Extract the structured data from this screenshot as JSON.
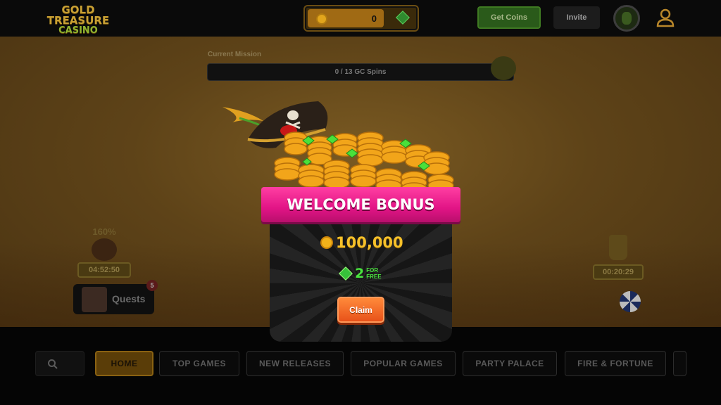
{
  "header": {
    "logo_line1": "GOLD TREASURE",
    "logo_line2": "CASINO",
    "balance_gc": "0",
    "get_coins_label": "Get Coins",
    "invite_label": "Invite"
  },
  "mission": {
    "label": "Current Mission",
    "progress_text": "0 / 13 GC Spins",
    "progress_fraction": 0
  },
  "side": {
    "boost_percent": "160%",
    "boost_timer": "04:52:50",
    "quests_label": "Quests",
    "quests_badge": "5",
    "trophy_timer": "00:20:29"
  },
  "modal": {
    "title": "WELCOME BONUS",
    "coins_amount": "100,000",
    "gems_amount": "2",
    "gems_suffix_line1": "FOR",
    "gems_suffix_line2": "FREE",
    "claim_label": "Claim"
  },
  "nav": {
    "tabs": [
      {
        "label": "HOME",
        "active": true
      },
      {
        "label": "TOP GAMES",
        "active": false
      },
      {
        "label": "NEW RELEASES",
        "active": false
      },
      {
        "label": "POPULAR GAMES",
        "active": false
      },
      {
        "label": "PARTY PALACE",
        "active": false
      },
      {
        "label": "FIRE & FORTUNE",
        "active": false
      }
    ]
  },
  "icons": {
    "search": "search-icon",
    "user": "user-icon",
    "coin": "coin-icon",
    "gem": "gem-icon",
    "trophy": "trophy-icon",
    "wheel": "prize-wheel-icon"
  },
  "colors": {
    "banner_pink": "#e21486",
    "coin_gold": "#f6c12a",
    "gem_green": "#49e43e",
    "claim_orange": "#e8521a",
    "active_tab": "#8a6212"
  }
}
